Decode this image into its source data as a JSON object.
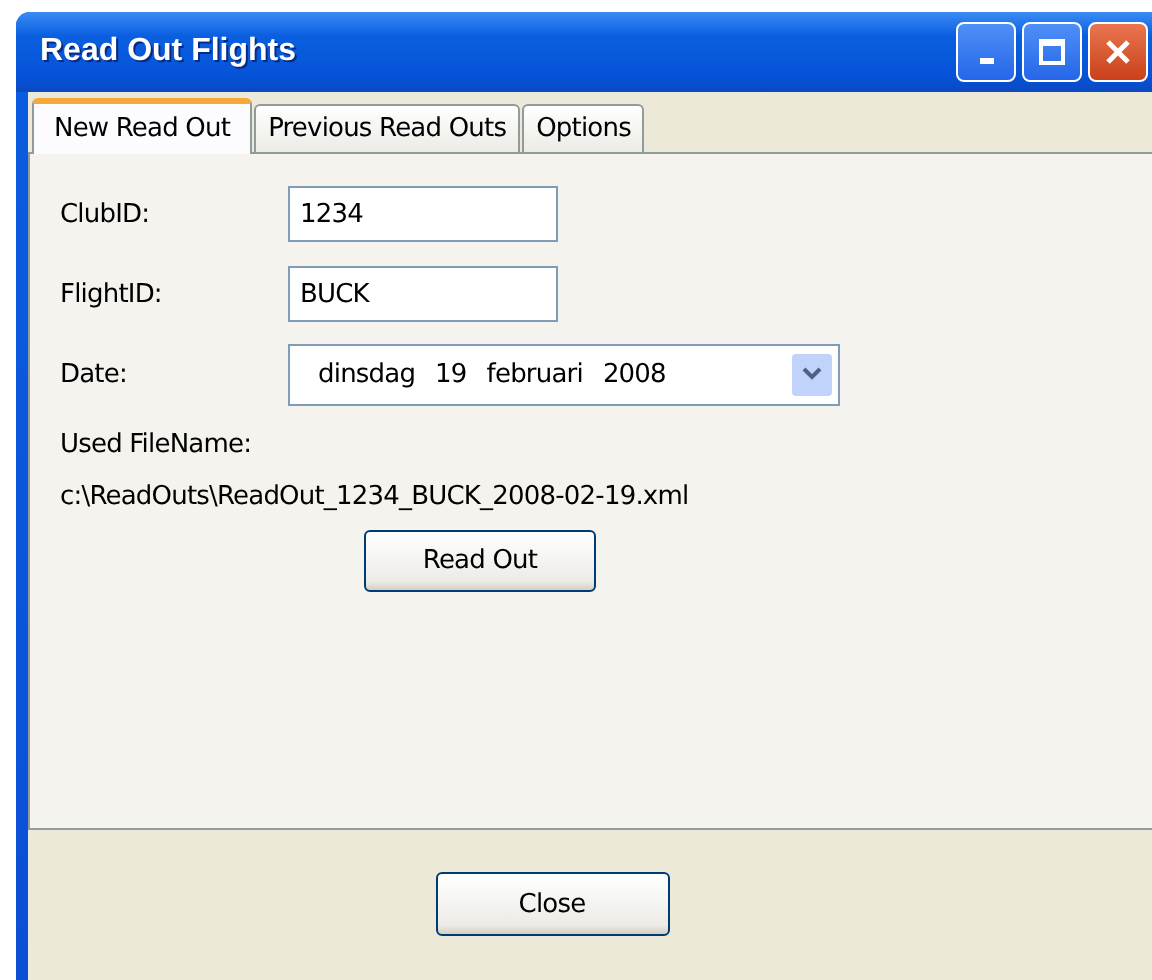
{
  "window": {
    "title": "Read Out Flights"
  },
  "tabs": [
    {
      "label": "New Read Out",
      "selected": true
    },
    {
      "label": "Previous Read Outs",
      "selected": false
    },
    {
      "label": "Options",
      "selected": false
    }
  ],
  "form": {
    "club_id": {
      "label": "ClubID:",
      "value": "1234"
    },
    "flight_id": {
      "label": "FlightID:",
      "value": "BUCK"
    },
    "date": {
      "label": "Date:",
      "weekday": "dinsdag",
      "day": "19",
      "month": "februari",
      "year": "2008"
    },
    "file_label": "Used FileName:",
    "file_path": "c:\\ReadOuts\\ReadOut_1234_BUCK_2008-02-19.xml",
    "read_button": "Read Out"
  },
  "buttons": [
    "Close"
  ]
}
